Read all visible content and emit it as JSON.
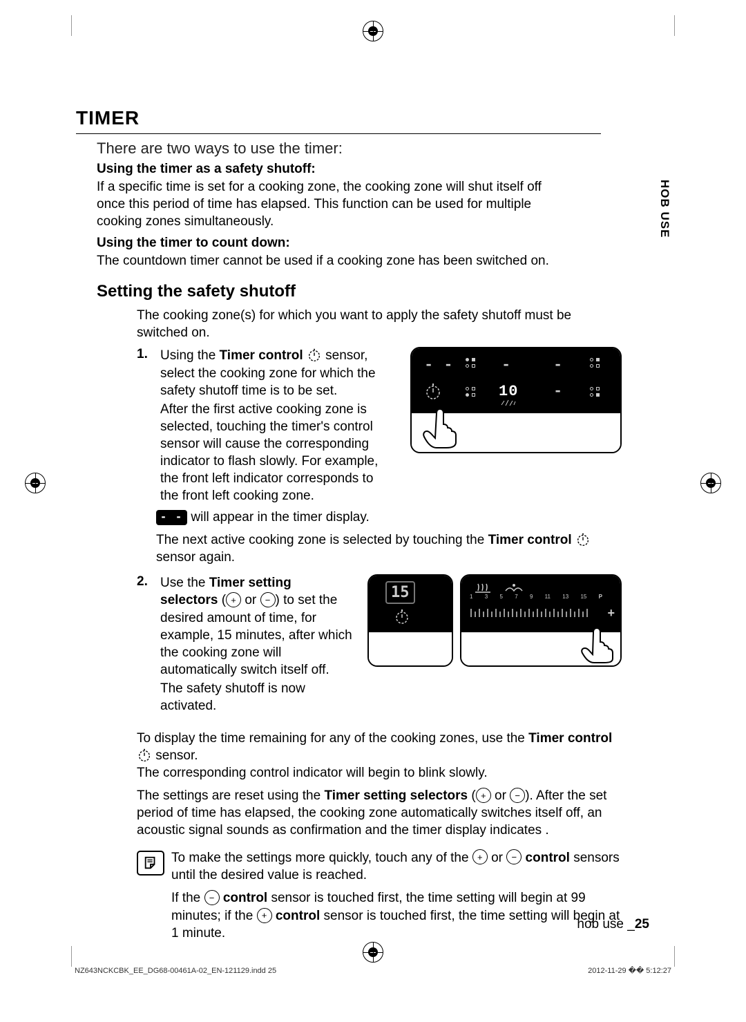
{
  "side_tab": "HOB USE",
  "heading": "TIMER",
  "intro": "There are two ways to use the timer:",
  "sub1_title": "Using the timer as a safety shutoff:",
  "sub1_body": "If a specific time is set for a cooking zone, the cooking zone will shut itself off once this period of time has elapsed. This function can be used for multiple cooking zones simultaneously.",
  "sub2_title": "Using the timer to count down:",
  "sub2_body": "The countdown timer cannot be used if a cooking zone has been switched on.",
  "section_heading": "Setting the safety shutoff",
  "section_intro": "The cooking zone(s) for which you want to apply the safety shutoff must be switched on.",
  "step1_num": "1.",
  "step1_a": "Using the ",
  "step1_bold1": "Timer control",
  "step1_b": " sensor, select the cooking zone for which the safety shutoff time is to be set.",
  "step1_c": "After the first active cooking zone is selected, touching the timer's control sensor will cause the corresponding indicator to flash slowly. For example, the front left indicator corresponds to the front left cooking zone.",
  "step1_badge": "- -",
  "step1_d": " will appear in the timer display.",
  "step1_e": "The next active cooking zone is selected by touching the ",
  "step1_bold2": "Timer control",
  "step1_f": " sensor again.",
  "step2_num": "2.",
  "step2_a": "Use the ",
  "step2_bold1": "Timer setting selectors",
  "step2_b": " (",
  "step2_c": " or ",
  "step2_d": ") to set the desired amount of time, for example, 15 minutes, after which the cooking zone will automatically switch itself off.",
  "step2_e": "The safety shutoff is now activated.",
  "after1_a": "To display the time remaining for any of the cooking zones, use the ",
  "after1_bold": "Timer control",
  "after1_b": " sensor.",
  "after1_c": "The corresponding control indicator will begin to blink slowly.",
  "after2_a": "The settings are reset using the ",
  "after2_bold": "Timer setting selectors",
  "after2_b": " (",
  "after2_c": " or ",
  "after2_d": "). After the set period of time has elapsed, the cooking zone automatically switches itself off, an acoustic signal sounds as confirmation and the timer display indicates .",
  "note1_a": "To make the settings more quickly, touch any of the ",
  "note1_b": " or ",
  "note1_bold": "control",
  "note1_c": " sensors until the desired value is reached.",
  "note2_a": "If the ",
  "note2_bold1": "control",
  "note2_b": " sensor is touched first, the time setting will begin at 99 minutes; if the ",
  "note2_bold2": "control",
  "note2_c": " sensor is touched first, the time setting will begin at 1 minute.",
  "panel1": {
    "timer": "- -",
    "zone_value": "10",
    "dash": "-"
  },
  "panel2": {
    "timer": "15",
    "marks": [
      "1",
      "3",
      "5",
      "7",
      "9",
      "11",
      "13",
      "15",
      "P"
    ],
    "plus": "+"
  },
  "footer_label": "hob use _",
  "footer_page": "25",
  "print_left": "NZ643NCKCBK_EE_DG68-00461A-02_EN-121129.indd   25",
  "print_right": "2012-11-29   �� 5:12:27"
}
